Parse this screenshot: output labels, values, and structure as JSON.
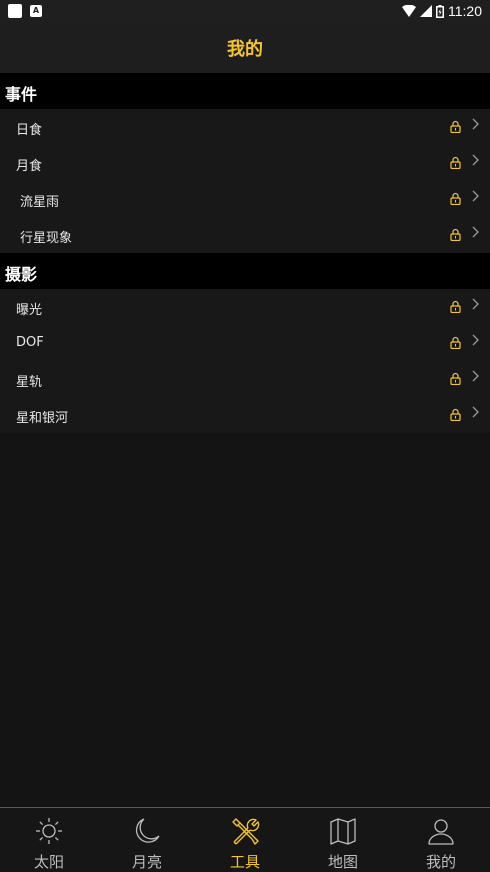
{
  "status_bar": {
    "time": "11:20",
    "icons": [
      "notification-icon",
      "a-icon",
      "wifi-icon",
      "signal-icon",
      "battery-icon"
    ]
  },
  "header": {
    "title": "我的"
  },
  "sections": [
    {
      "title": "事件",
      "items": [
        {
          "label": "日食",
          "locked": true
        },
        {
          "label": "月食",
          "locked": true
        },
        {
          "label": "流星雨",
          "locked": true
        },
        {
          "label": "行星现象",
          "locked": true
        }
      ]
    },
    {
      "title": "摄影",
      "items": [
        {
          "label": "曝光",
          "locked": true
        },
        {
          "label": "DOF",
          "locked": true
        },
        {
          "label": "星轨",
          "locked": true
        },
        {
          "label": "星和银河",
          "locked": true
        }
      ]
    }
  ],
  "tabs": [
    {
      "label": "太阳",
      "icon": "sun-icon",
      "active": false
    },
    {
      "label": "月亮",
      "icon": "moon-icon",
      "active": false
    },
    {
      "label": "工具",
      "icon": "tools-icon",
      "active": true
    },
    {
      "label": "地图",
      "icon": "map-icon",
      "active": false
    },
    {
      "label": "我的",
      "icon": "user-icon",
      "active": false
    }
  ],
  "colors": {
    "accent": "#f5c431",
    "background": "#141414",
    "header_bg": "#1e1e1e",
    "section_bg": "#000000"
  }
}
